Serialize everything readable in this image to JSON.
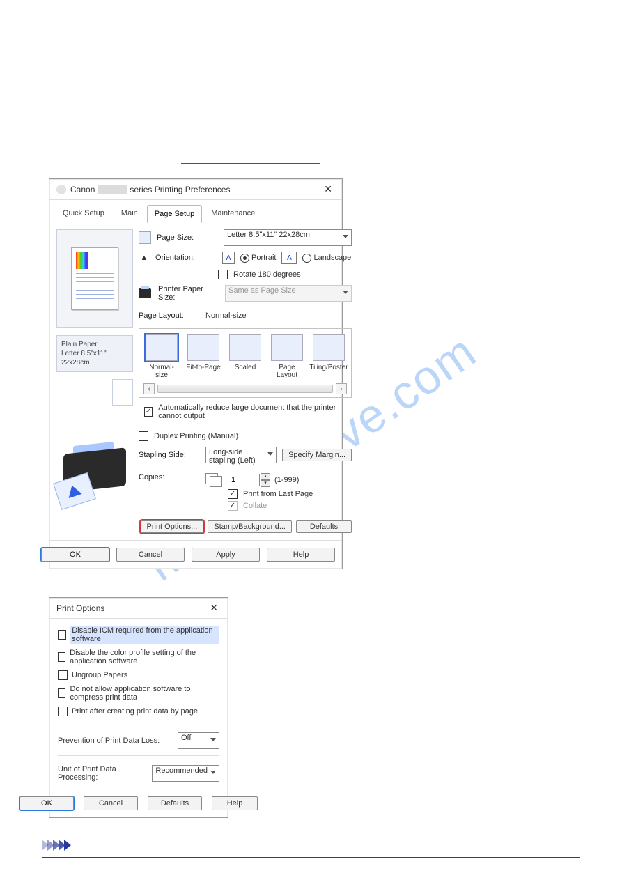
{
  "watermark": "manualshive.com",
  "prefs": {
    "title_prefix": "Canon ",
    "title_suffix": " series Printing Preferences",
    "tabs": [
      "Quick Setup",
      "Main",
      "Page Setup",
      "Maintenance"
    ],
    "paper": {
      "type": "Plain Paper",
      "size": "Letter 8.5\"x11\" 22x28cm"
    },
    "fields": {
      "page_size_label": "Page Size:",
      "page_size_value": "Letter 8.5\"x11\" 22x28cm",
      "orientation_label": "Orientation:",
      "portrait": "Portrait",
      "landscape": "Landscape",
      "rotate180": "Rotate 180 degrees",
      "printer_paper_label": "Printer Paper Size:",
      "printer_paper_value": "Same as Page Size",
      "page_layout_label": "Page Layout:",
      "page_layout_value": "Normal-size",
      "auto_reduce": "Automatically reduce large document that the printer cannot output",
      "duplex": "Duplex Printing (Manual)",
      "stapling_label": "Stapling Side:",
      "stapling_value": "Long-side stapling (Left)",
      "copies_label": "Copies:",
      "copies_value": "1",
      "copies_range": "(1-999)",
      "print_last": "Print from Last Page",
      "collate": "Collate"
    },
    "layouts": [
      "Normal-size",
      "Fit-to-Page",
      "Scaled",
      "Page Layout",
      "Tiling/Poster"
    ],
    "buttons": {
      "specify_margin": "Specify Margin...",
      "print_options": "Print Options...",
      "stamp": "Stamp/Background...",
      "defaults": "Defaults"
    },
    "footer": {
      "ok": "OK",
      "cancel": "Cancel",
      "apply": "Apply",
      "help": "Help"
    }
  },
  "options": {
    "title": "Print Options",
    "items": [
      "Disable ICM required from the application software",
      "Disable the color profile setting of the application software",
      "Ungroup Papers",
      "Do not allow application software to compress print data",
      "Print after creating print data by page"
    ],
    "prevention_label": "Prevention of Print Data Loss:",
    "prevention_value": "Off",
    "unit_label": "Unit of Print Data Processing:",
    "unit_value": "Recommended",
    "footer": {
      "ok": "OK",
      "cancel": "Cancel",
      "defaults": "Defaults",
      "help": "Help"
    }
  }
}
